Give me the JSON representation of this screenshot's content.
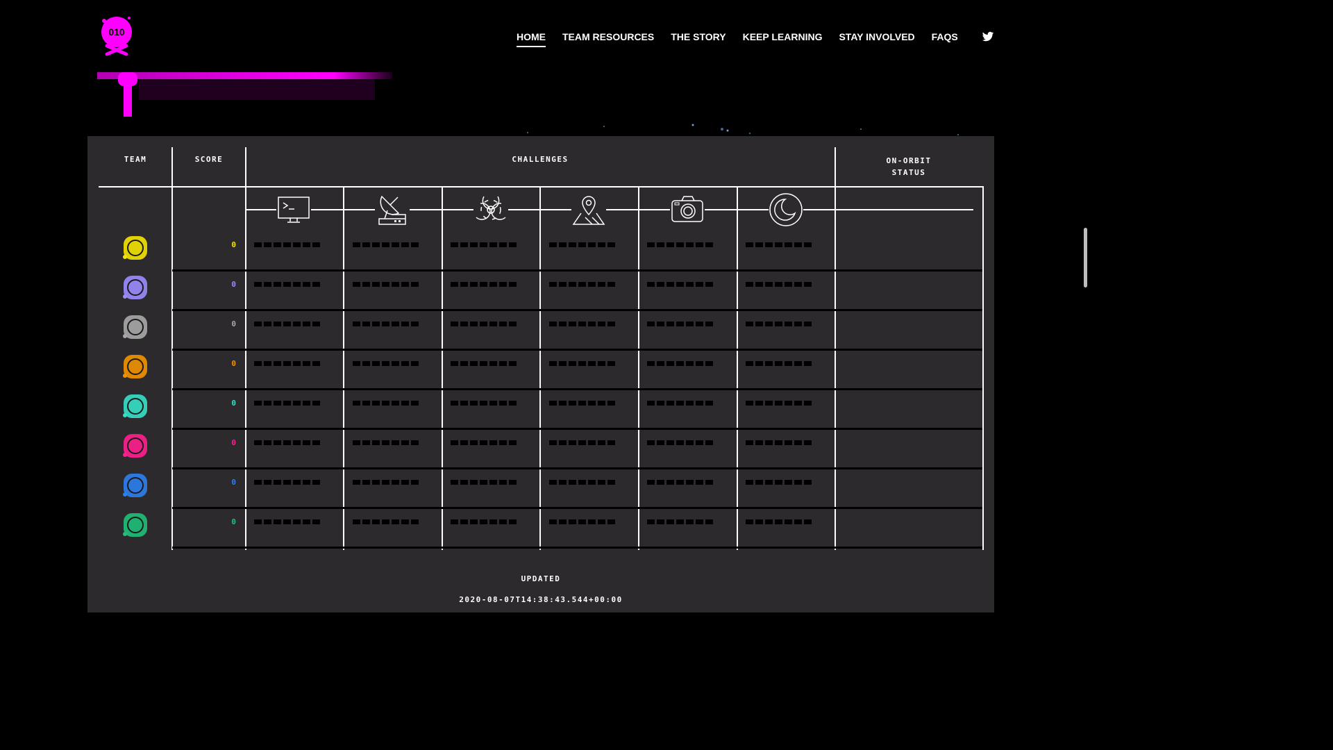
{
  "nav": {
    "items": [
      "HOME",
      "TEAM RESOURCES",
      "THE STORY",
      "KEEP LEARNING",
      "STAY INVOLVED",
      "FAQS"
    ],
    "active": "HOME"
  },
  "logo": {
    "text": "010",
    "color": "#ff00ff"
  },
  "table": {
    "headers": {
      "team": "TEAM",
      "score": "SCORE",
      "challenges": "CHALLENGES",
      "status_line1": "ON-ORBIT",
      "status_line2": "STATUS"
    },
    "challenge_icons": [
      "terminal-icon",
      "satellite-dish-icon",
      "biohazard-icon",
      "map-pin-icon",
      "camera-icon",
      "moon-icon"
    ],
    "teams": [
      {
        "icon": "team-5-icon",
        "score": "0",
        "color": "#f4e400"
      },
      {
        "icon": "team-solar-wine-icon",
        "score": "0",
        "color": "#9a8cff"
      },
      {
        "icon": "team-grey-dots-icon",
        "score": "0",
        "color": "#a8a8a8"
      },
      {
        "icon": "team-orange-box-icon",
        "score": "0",
        "color": "#f39200"
      },
      {
        "icon": "team-samurai-icon",
        "score": "0",
        "color": "#36e0c8"
      },
      {
        "icon": "team-pink-hand-icon",
        "score": "0",
        "color": "#ff1f8f"
      },
      {
        "icon": "team-blue-15-icon",
        "score": "0",
        "color": "#2e7ff0"
      },
      {
        "icon": "team-green-can-icon",
        "score": "0",
        "color": "#1fc07a"
      }
    ]
  },
  "footer": {
    "label": "UPDATED",
    "timestamp": "2020-08-07T14:38:43.544+00:00"
  }
}
